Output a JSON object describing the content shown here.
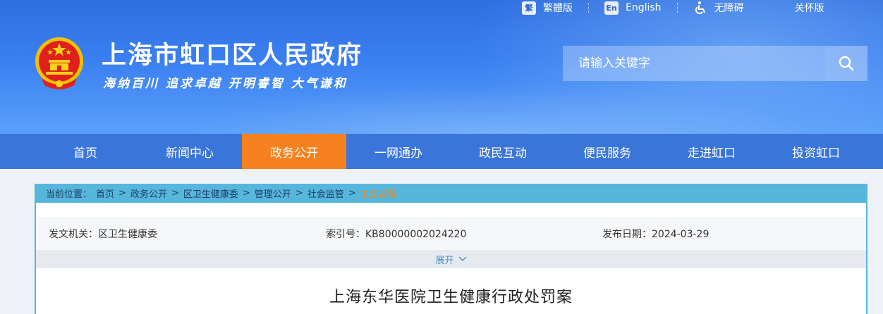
{
  "toplinks": {
    "traditional": {
      "icon": "繁",
      "label": "繁體版"
    },
    "english": {
      "icon": "En",
      "label": "English"
    },
    "accessibility": {
      "label": "无障碍"
    },
    "care": {
      "label": "关怀版"
    }
  },
  "header": {
    "title": "上海市虹口区人民政府",
    "slogan": "海纳百川  追求卓越  开明睿智  大气谦和"
  },
  "search": {
    "placeholder": "请输入关键字"
  },
  "nav": {
    "items": [
      {
        "label": "首页"
      },
      {
        "label": "新闻中心"
      },
      {
        "label": "政务公开"
      },
      {
        "label": "一网通办"
      },
      {
        "label": "政民互动"
      },
      {
        "label": "便民服务"
      },
      {
        "label": "走进虹口"
      },
      {
        "label": "投资虹口"
      }
    ],
    "active_index": 2
  },
  "breadcrumb": {
    "prefix": "当前位置：",
    "items": [
      "首页",
      "政务公开",
      "区卫生健康委",
      "管理公开",
      "社会监管",
      "卫生监督"
    ]
  },
  "meta": {
    "issuer": "发文机关：区卫生健康委",
    "index": "索引号：KB80000002024220",
    "date": "发布日期：2024-03-29"
  },
  "expand_label": "展开",
  "document": {
    "title": "上海东华医院卫生健康行政处罚案"
  },
  "colors": {
    "header_blue": "#3a7ff0",
    "nav_blue": "#3a75d9",
    "nav_active": "#f5821f",
    "breadcrumb_bar": "#57b6dc",
    "breadcrumb_current": "#e0892a"
  }
}
